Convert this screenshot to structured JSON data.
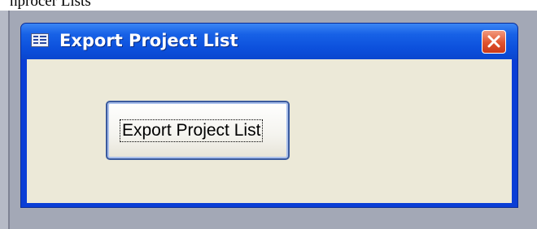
{
  "page": {
    "top_text": "nprocer Lists"
  },
  "window": {
    "title": "Export Project List",
    "icon": "form-icon",
    "close_icon": "close-icon",
    "close_color": "#e0532e",
    "titlebar_color": "#0c50dc",
    "client_color": "#ece9d8"
  },
  "form": {
    "export_button_label": "Export Project List"
  }
}
